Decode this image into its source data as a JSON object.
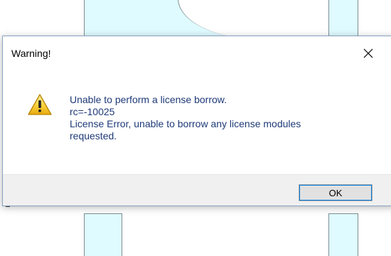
{
  "dialog": {
    "title": "Warning!",
    "close_icon": "close-icon",
    "icon": "warning-icon",
    "message_lines": [
      "Unable to perform a license borrow.",
      "rc=-10025",
      "License Error, unable to borrow any license modules",
      "requested."
    ],
    "ok_label": "OK"
  },
  "colors": {
    "message_text": "#1e3a78",
    "footer_bg": "#f0f0f0",
    "button_bg": "#e1e1e1",
    "button_focus": "#0078d7",
    "background_panel": "#dffbff"
  }
}
